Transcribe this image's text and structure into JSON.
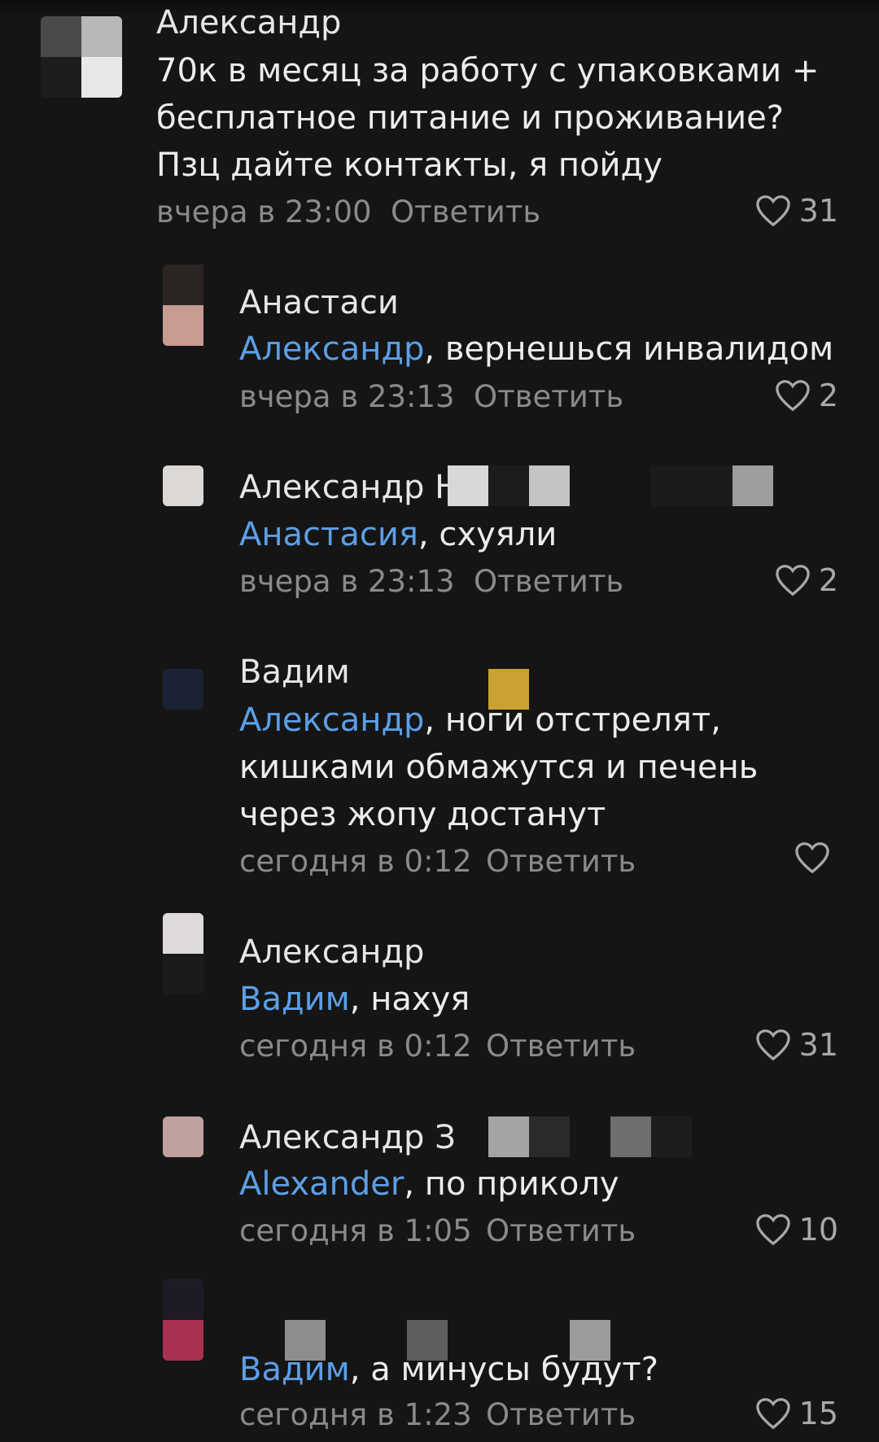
{
  "comments": [
    {
      "author": "Александр",
      "mention": "",
      "text": "70к в месяц за работу с упаковками + бесплатное питание и проживание? Пзц дайте контакты, я пойду",
      "time": "вчера в 23:00",
      "reply_label": "Ответить",
      "likes": "31"
    },
    {
      "author": "Анастаси",
      "mention": "Александр",
      "text": ", вернешься инвалидом",
      "time": "вчера в 23:13",
      "reply_label": "Ответить",
      "likes": "2"
    },
    {
      "author": "Александр Н",
      "mention": "Анастасия",
      "text": ", схуяли",
      "time": "вчера в 23:13",
      "reply_label": "Ответить",
      "likes": "2"
    },
    {
      "author": "Вадим",
      "mention": "Александр",
      "text": ", ноги отстрелят, кишками обмажутся и печень через жопу достанут",
      "time": "сегодня в 0:12",
      "reply_label": "Ответить",
      "likes": ""
    },
    {
      "author": "Александр",
      "mention": "Вадим",
      "text": ", нахуя",
      "time": "сегодня в 0:12",
      "reply_label": "Ответить",
      "likes": "31"
    },
    {
      "author": "Александр З",
      "mention": "Alexander",
      "text": ", по приколу",
      "time": "сегодня в 1:05",
      "reply_label": "Ответить",
      "likes": "10"
    },
    {
      "author": "",
      "mention": "Вадим",
      "text": ", а минусы будут?",
      "time": "сегодня в 1:23",
      "reply_label": "Ответить",
      "likes": "15"
    }
  ],
  "colors": {
    "background": "#151515",
    "mention": "#5c9fe6",
    "meta": "#8a8a8a",
    "text": "#ececec"
  },
  "icons": {
    "like": "heart-outline-icon"
  }
}
